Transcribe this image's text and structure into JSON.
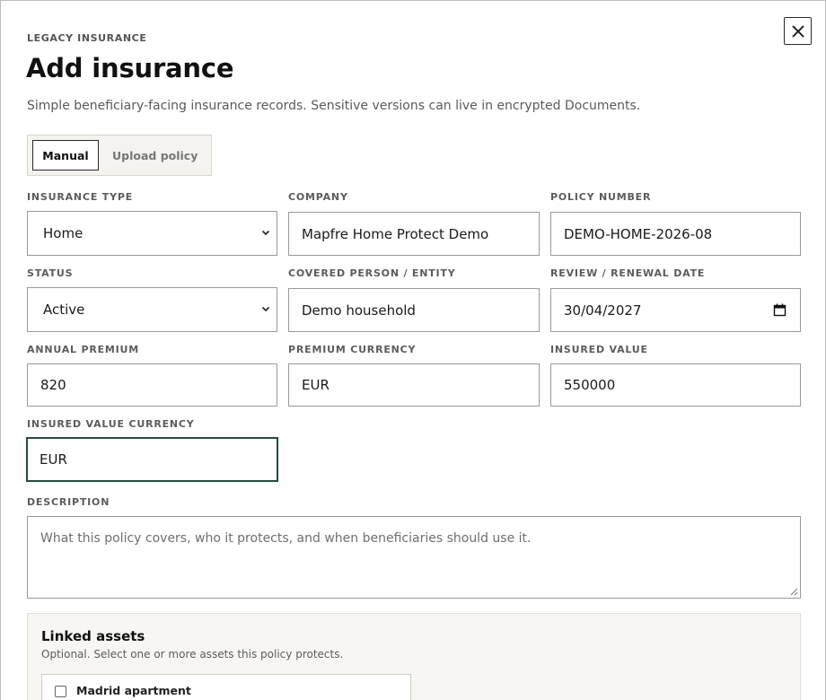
{
  "modal": {
    "eyebrow": "LEGACY INSURANCE",
    "title": "Add insurance",
    "subtitle": "Simple beneficiary-facing insurance records. Sensitive versions can live in encrypted Documents.",
    "close_icon": "close-icon"
  },
  "tabs": [
    {
      "label": "Manual",
      "active": true
    },
    {
      "label": "Upload policy",
      "active": false
    }
  ],
  "form": {
    "insurance_type": {
      "label": "INSURANCE TYPE",
      "value": "Home"
    },
    "company": {
      "label": "COMPANY",
      "value": "Mapfre Home Protect Demo"
    },
    "policy_number": {
      "label": "POLICY NUMBER",
      "value": "DEMO-HOME-2026-08"
    },
    "status": {
      "label": "STATUS",
      "value": "Active"
    },
    "covered_person": {
      "label": "COVERED PERSON / ENTITY",
      "value": "Demo household"
    },
    "review_date": {
      "label": "REVIEW / RENEWAL DATE",
      "value": "30/04/2027"
    },
    "annual_premium": {
      "label": "ANNUAL PREMIUM",
      "value": "820"
    },
    "premium_currency": {
      "label": "PREMIUM CURRENCY",
      "value": "EUR"
    },
    "insured_value": {
      "label": "INSURED VALUE",
      "value": "550000"
    },
    "insured_value_currency": {
      "label": "INSURED VALUE CURRENCY",
      "value": "EUR"
    },
    "description": {
      "label": "DESCRIPTION",
      "placeholder": "What this policy covers, who it protects, and when beneficiaries should use it."
    }
  },
  "linked_assets": {
    "title": "Linked assets",
    "description": "Optional. Select one or more assets this policy protects.",
    "items": [
      {
        "label": "Madrid apartment",
        "checked": false
      }
    ]
  },
  "colors": {
    "focus_border": "#244b3f",
    "panel_bg": "#f7f6f2",
    "tab_bg": "#f4f3ef"
  }
}
